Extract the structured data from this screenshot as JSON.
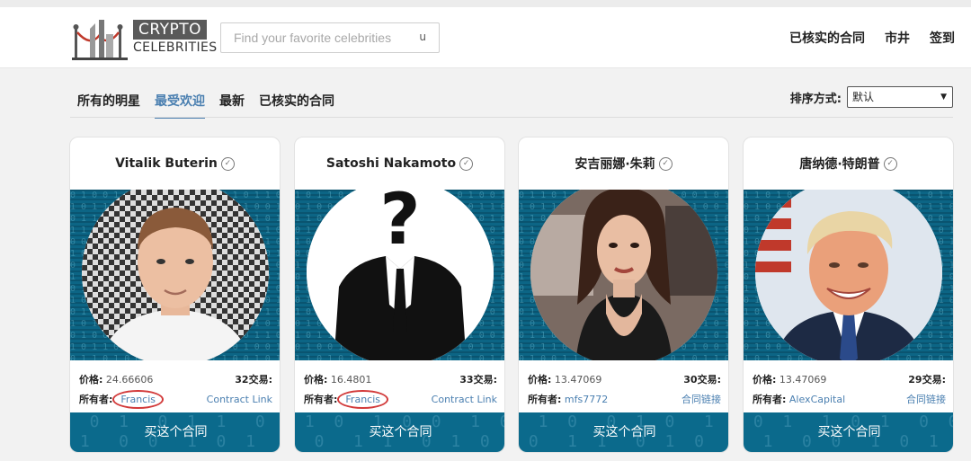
{
  "header": {
    "logo_top": "CRYPTO",
    "logo_bottom": "CELEBRITIES",
    "search_placeholder": "Find your favorite celebrities",
    "search_icon": "u",
    "nav": [
      "已核实的合同",
      "市井",
      "签到"
    ]
  },
  "tabs": [
    "所有的明星",
    "最受欢迎",
    "最新",
    "已核实的合同"
  ],
  "active_tab": "最受欢迎",
  "sort": {
    "label": "排序方式:",
    "selected": "默认"
  },
  "labels": {
    "price": "价格:",
    "owner": "所有者:"
  },
  "colors": {
    "accent": "#4a7fb0",
    "matrix": "#0c6585",
    "owner_highlight": "#d23a3a"
  },
  "cards": [
    {
      "name": "Vitalik Buterin",
      "price": "24.66606",
      "trades": "32交易:",
      "owner": "Francis",
      "contract": "Contract Link",
      "buy": "买这个合同",
      "owner_circled": true
    },
    {
      "name": "Satoshi Nakamoto",
      "price": "16.4801",
      "trades": "33交易:",
      "owner": "Francis",
      "contract": "Contract Link",
      "buy": "买这个合同",
      "owner_circled": true
    },
    {
      "name": "安吉丽娜·朱莉",
      "price": "13.47069",
      "trades": "30交易:",
      "owner": "mfs7772",
      "contract": "合同链接",
      "buy": "买这个合同",
      "owner_circled": false
    },
    {
      "name": "唐纳德·特朗普",
      "price": "13.47069",
      "trades": "29交易:",
      "owner": "AlexCapital",
      "contract": "合同链接",
      "buy": "买这个合同",
      "owner_circled": false
    }
  ]
}
